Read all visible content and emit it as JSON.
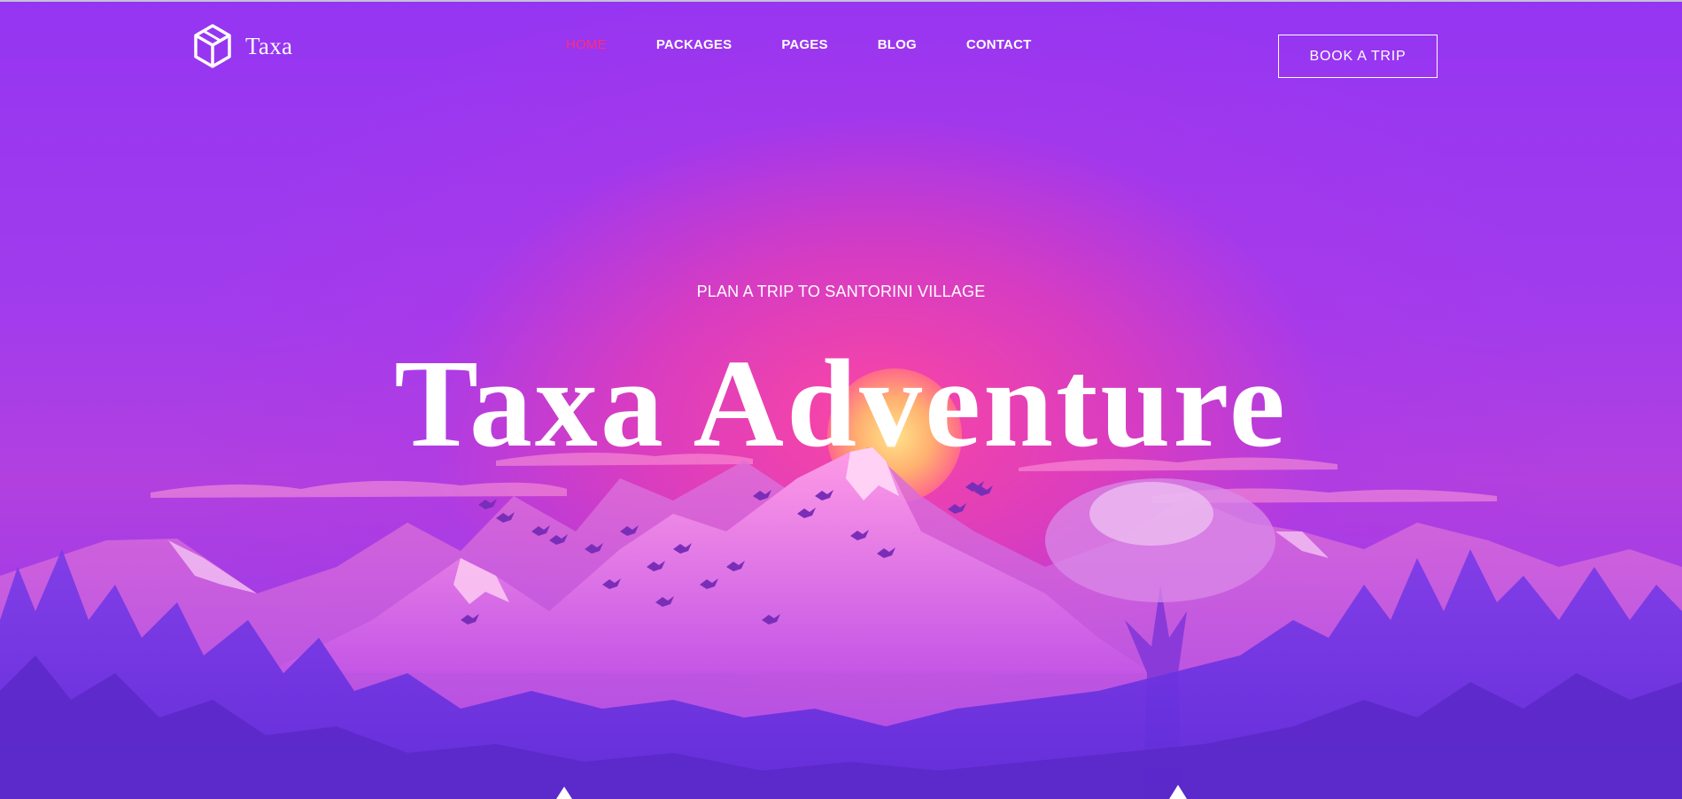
{
  "brand": {
    "name": "Taxa",
    "icon": "cube-icon"
  },
  "nav": {
    "items": [
      {
        "label": "HOME",
        "active": true
      },
      {
        "label": "PACKAGES",
        "active": false
      },
      {
        "label": "PAGES",
        "active": false
      },
      {
        "label": "BLOG",
        "active": false
      },
      {
        "label": "CONTACT",
        "active": false
      }
    ]
  },
  "header": {
    "cta_label": "BOOK A TRIP"
  },
  "hero": {
    "subtitle": "PLAN A TRIP TO SANTORINI VILLAGE",
    "title": "Taxa Adventure"
  },
  "colors": {
    "accent_active": "#ff2d7a",
    "background_top": "#9535f2",
    "glow": "#ff46a0"
  }
}
